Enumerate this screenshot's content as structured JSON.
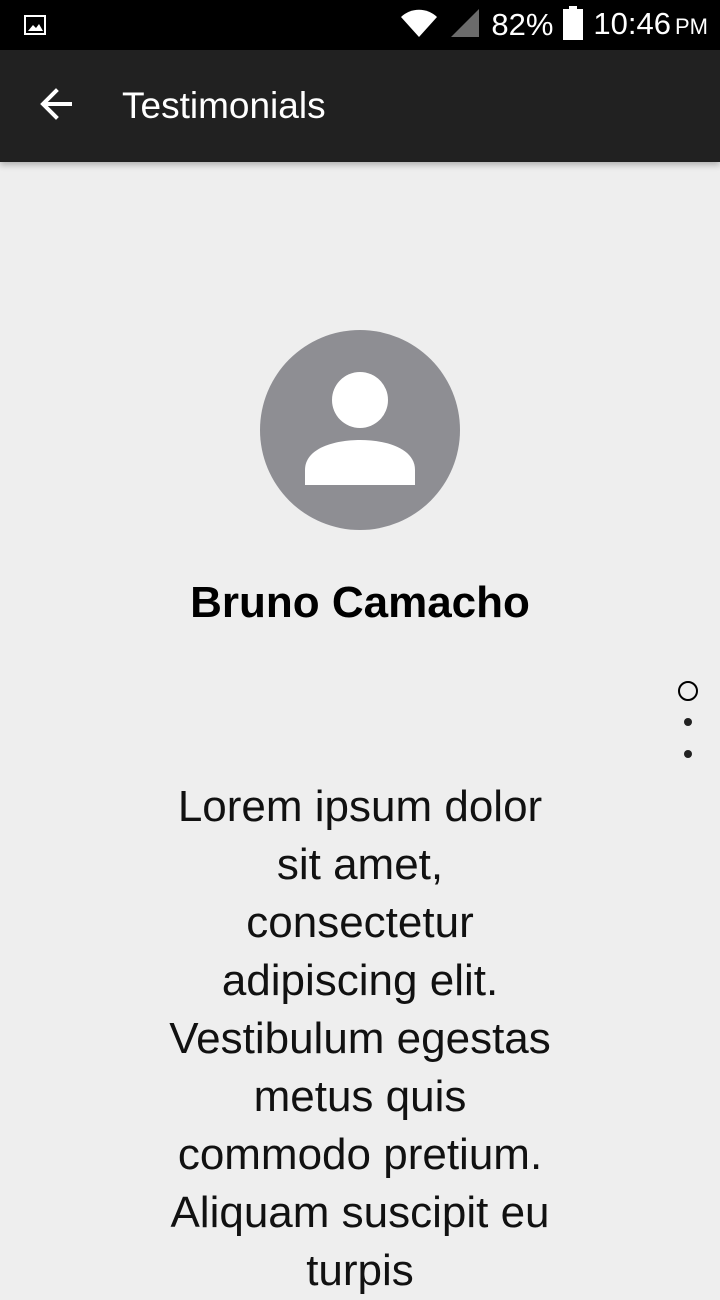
{
  "status_bar": {
    "battery": "82%",
    "time": "10:46",
    "ampm": "PM",
    "icons": [
      "gallery-notification-icon",
      "wifi-icon",
      "signal-icon",
      "battery-icon"
    ]
  },
  "app_bar": {
    "back_icon": "arrow-left-icon",
    "title": "Testimonials"
  },
  "testimonial": {
    "avatar_icon": "person-icon",
    "name": "Bruno Camacho",
    "text": "Lorem ipsum dolor sit amet, consectetur adipiscing elit. Vestibulum egestas metus quis commodo pretium. Aliquam suscipit eu turpis"
  },
  "pager": {
    "count": 3,
    "current": 1
  },
  "colors": {
    "status_bar_bg": "#000000",
    "app_bar_bg": "#212121",
    "page_bg": "#eeeeee",
    "avatar_bg": "#8e8e93"
  }
}
